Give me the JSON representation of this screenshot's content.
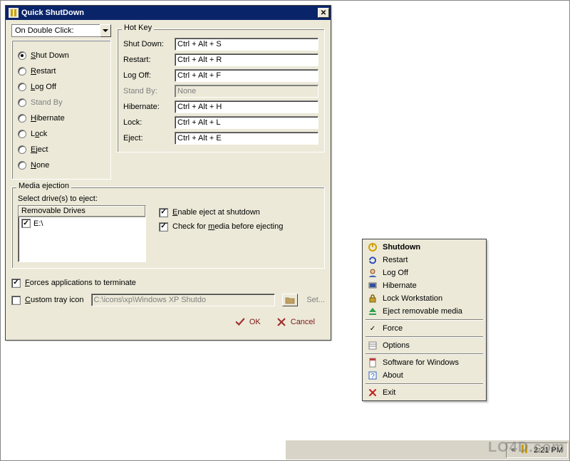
{
  "window": {
    "title": "Quick ShutDown",
    "close_symbol": "✕"
  },
  "doubleclick": {
    "combo": "On Double Click:",
    "options": [
      {
        "label": "Shut Down",
        "accel": "S",
        "selected": true,
        "disabled": false
      },
      {
        "label": "Restart",
        "accel": "R",
        "selected": false,
        "disabled": false
      },
      {
        "label": "Log Off",
        "accel": "L",
        "selected": false,
        "disabled": false
      },
      {
        "label": "Stand By",
        "accel": "",
        "selected": false,
        "disabled": true
      },
      {
        "label": "Hibernate",
        "accel": "H",
        "selected": false,
        "disabled": false
      },
      {
        "label": "Lock",
        "accel": "o",
        "selected": false,
        "disabled": false
      },
      {
        "label": "Eject",
        "accel": "E",
        "selected": false,
        "disabled": false
      },
      {
        "label": "None",
        "accel": "N",
        "selected": false,
        "disabled": false
      }
    ]
  },
  "hotkey": {
    "legend": "Hot Key",
    "rows": [
      {
        "label": "Shut Down:",
        "value": "Ctrl + Alt + S",
        "disabled": false
      },
      {
        "label": "Restart:",
        "value": "Ctrl + Alt + R",
        "disabled": false
      },
      {
        "label": "Log Off:",
        "value": "Ctrl + Alt + F",
        "disabled": false
      },
      {
        "label": "Stand By:",
        "value": "None",
        "disabled": true
      },
      {
        "label": "Hibernate:",
        "value": "Ctrl + Alt + H",
        "disabled": false
      },
      {
        "label": "Lock:",
        "value": "Ctrl + Alt + L",
        "disabled": false
      },
      {
        "label": "Eject:",
        "value": "Ctrl + Alt + E",
        "disabled": false
      }
    ]
  },
  "media": {
    "legend": "Media ejection",
    "instruction": "Select drive(s) to eject:",
    "list_header": "Removable Drives",
    "drives": [
      {
        "label": "E:\\",
        "checked": true
      }
    ],
    "enable_eject": {
      "label": "Enable eject at shutdown",
      "checked": true,
      "accel": "E"
    },
    "check_media": {
      "label": "Check for media before ejecting",
      "checked": true,
      "accel": "m"
    }
  },
  "bottom": {
    "force": {
      "label": "Forces applications to terminate",
      "checked": true,
      "accel": "F"
    },
    "custom_icon": {
      "label": "Custom tray icon",
      "checked": false,
      "accel": "C"
    },
    "icon_path": "C:\\icons\\xp\\Windows XP Shutdo",
    "set_label": "Set..."
  },
  "buttons": {
    "ok": "OK",
    "cancel": "Cancel"
  },
  "ctxmenu": {
    "items": [
      {
        "label": "Shutdown",
        "icon": "shutdown",
        "bold": true
      },
      {
        "label": "Restart",
        "icon": "restart",
        "bold": false
      },
      {
        "label": "Log Off",
        "icon": "logoff",
        "bold": false
      },
      {
        "label": "Hibernate",
        "icon": "hibernate",
        "bold": false
      },
      {
        "label": "Lock Workstation",
        "icon": "lock",
        "bold": false
      },
      {
        "label": "Eject removable media",
        "icon": "eject",
        "bold": false
      }
    ],
    "force": {
      "label": "Force",
      "checked": true
    },
    "options": {
      "label": "Options",
      "icon": "options"
    },
    "links": [
      {
        "label": "Software for Windows",
        "icon": "page"
      },
      {
        "label": "About",
        "icon": "help"
      }
    ],
    "exit": {
      "label": "Exit",
      "icon": "exit"
    }
  },
  "taskbar": {
    "arrow": "«",
    "clock": "2:21 PM"
  },
  "watermark": "LO4D.com"
}
